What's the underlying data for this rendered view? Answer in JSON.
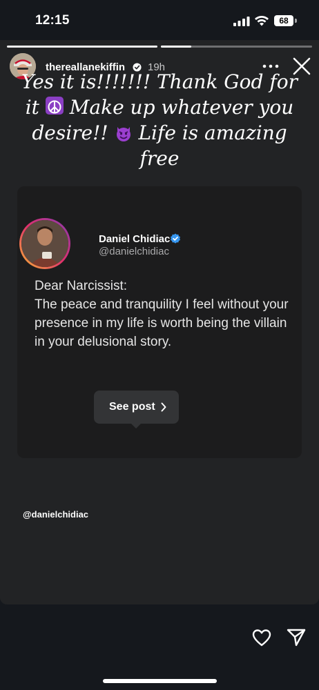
{
  "status_bar": {
    "time": "12:15",
    "battery": "68",
    "icons": [
      "signal-icon",
      "wifi-icon",
      "battery-icon"
    ]
  },
  "story": {
    "progress": [
      1.0,
      0.2
    ],
    "username": "thereallanekiffin",
    "age": "19h",
    "caption": {
      "line1": "Yes it is!!!!!!! Thank God for",
      "line2a": "it",
      "line2b": "Make up whatever you",
      "line3a": "desire!!",
      "line3b": "Life is amazing",
      "line4": "free"
    },
    "emojis": [
      "peace-symbol-icon",
      "smiling-devil-icon"
    ]
  },
  "shared_post": {
    "author_name": "Daniel Chidiac",
    "author_handle": "@danielchidiac",
    "text_line1": "Dear Narcissist:",
    "text_line2": "The peace and tranquility I feel without your presence in my life is worth being the villain in your delusional story.",
    "see_post_label": "See post"
  },
  "mention": "@danielchidiac",
  "colors": {
    "background": "#15181d",
    "card": "#222325",
    "post_card": "#1c1c1d",
    "verified": "#3797f0"
  }
}
